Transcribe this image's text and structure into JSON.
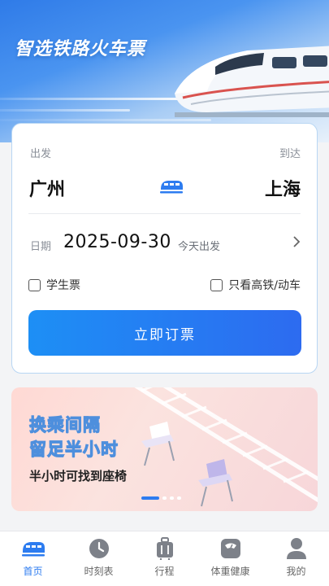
{
  "hero": {
    "title": "智选铁路火车票"
  },
  "booking": {
    "from_label": "出发",
    "to_label": "到达",
    "from_city": "广州",
    "to_city": "上海",
    "date_label": "日期",
    "date_value": "2025-09-30",
    "date_hint": "今天出发",
    "student_label": "学生票",
    "high_speed_label": "只看高铁/动车",
    "book_button": "立即订票"
  },
  "promo": {
    "line1": "换乘间隔",
    "line2": "留足半小时",
    "subtitle": "半小时可找到座椅",
    "slide_index": 1,
    "slide_count": 4
  },
  "nav": {
    "items": [
      {
        "label": "首页",
        "icon": "train-icon",
        "active": true
      },
      {
        "label": "时刻表",
        "icon": "clock-icon",
        "active": false
      },
      {
        "label": "行程",
        "icon": "luggage-icon",
        "active": false
      },
      {
        "label": "体重健康",
        "icon": "scale-icon",
        "active": false
      },
      {
        "label": "我的",
        "icon": "user-icon",
        "active": false
      }
    ]
  },
  "colors": {
    "accent": "#2d7cf0",
    "card_border": "#b8d6f3"
  }
}
